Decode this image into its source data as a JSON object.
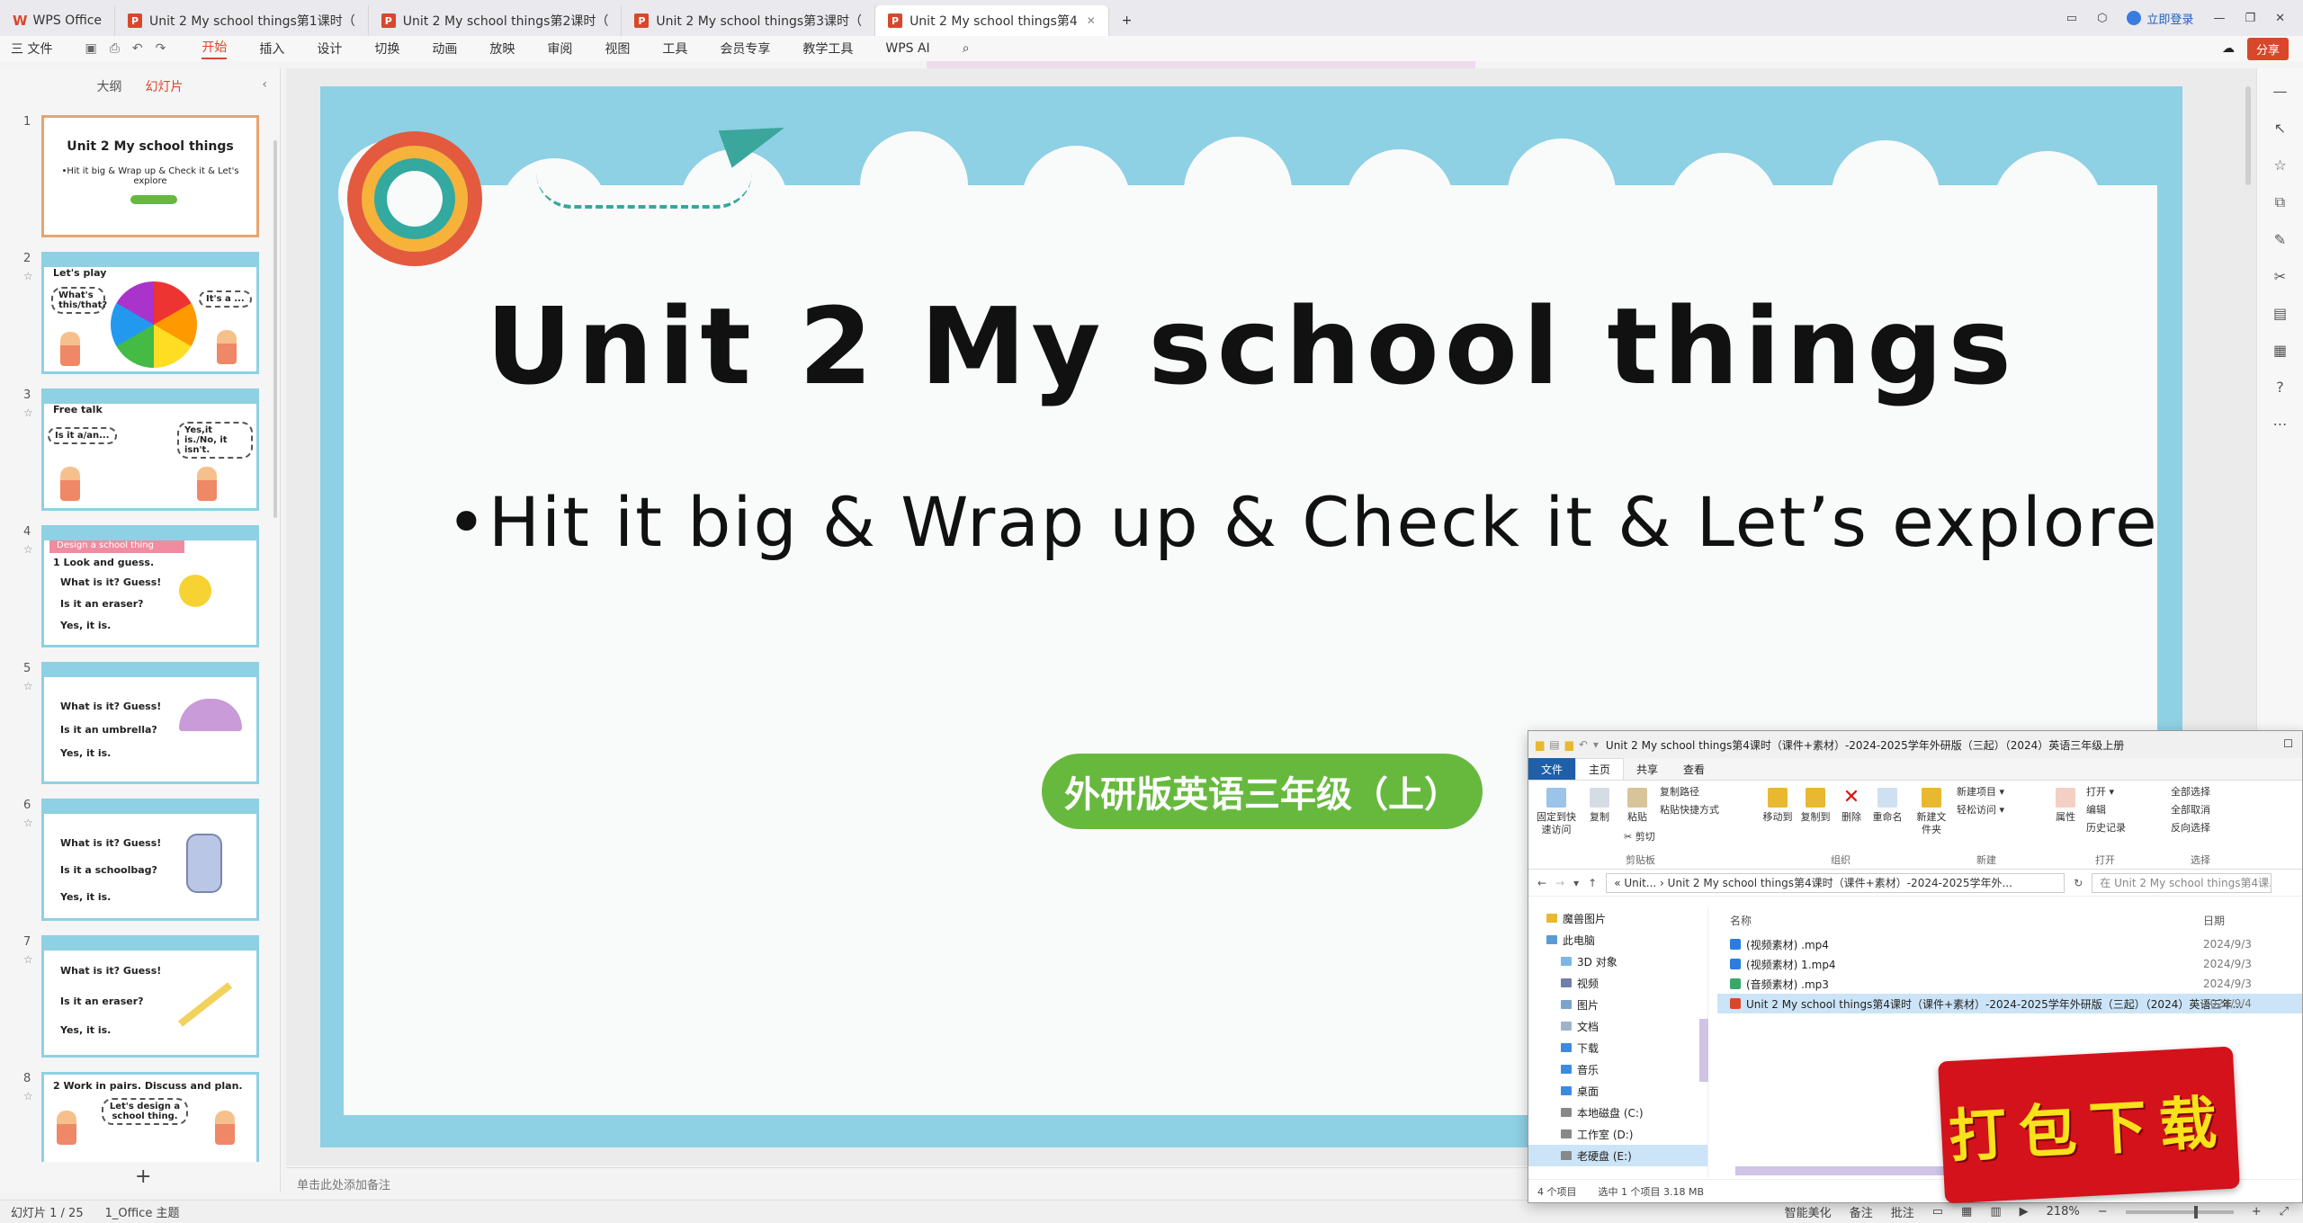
{
  "tabs": {
    "wps": "WPS Office",
    "t1": "Unit 2 My school things第1课时（",
    "t2": "Unit 2 My school things第2课时（",
    "t3": "Unit 2 My school things第3课时（",
    "t4": "Unit 2 My school things第4",
    "add": "+",
    "login": "立即登录"
  },
  "menu": {
    "file": "三 文件",
    "items": [
      "开始",
      "插入",
      "设计",
      "切换",
      "动画",
      "放映",
      "审阅",
      "视图",
      "工具",
      "会员专享",
      "教学工具"
    ],
    "wps_ai": "WPS AI",
    "share": "分享"
  },
  "left_panel": {
    "tab_outline": "大纲",
    "tab_slides": "幻灯片",
    "add": "+"
  },
  "thumbs": {
    "s1": {
      "num": "1",
      "title": "Unit 2 My school things",
      "sub": "•Hit it big & Wrap up & Check it & Let's explore"
    },
    "s2": {
      "num": "2",
      "a": "Let's play",
      "b": "What's this/that?",
      "c": "It's a ..."
    },
    "s3": {
      "num": "3",
      "a": "Free talk",
      "b": "Is it a/an...",
      "c": "Yes,it is./No, it isn't."
    },
    "s4": {
      "num": "4",
      "tag": "Design a school thing",
      "a": "1  Look and guess.",
      "b": "What is it? Guess!",
      "c": "Is it an eraser?",
      "d": "Yes, it is."
    },
    "s5": {
      "num": "5",
      "a": "What is it? Guess!",
      "b": "Is it an umbrella?",
      "c": "Yes, it is."
    },
    "s6": {
      "num": "6",
      "a": "What is it? Guess!",
      "b": "Is it a schoolbag?",
      "c": "Yes, it is."
    },
    "s7": {
      "num": "7",
      "a": "What is it? Guess!",
      "b": "Is it an eraser?",
      "c": "Yes, it is."
    },
    "s8": {
      "num": "8",
      "a": "2 Work in pairs. Discuss and plan.",
      "b": "Let's design a school thing."
    }
  },
  "slide": {
    "title": "Unit 2 My school things",
    "subtitle": "•Hit it big & Wrap up & Check it & Let’s explore",
    "badge": "外研版英语三年级（上）"
  },
  "notes_placeholder": "单击此处添加备注",
  "status": {
    "slide_count": "幻灯片 1 / 25",
    "theme": "1_Office 主题",
    "beautify": "智能美化",
    "notes": "备注",
    "comments": "批注",
    "zoom": "218%"
  },
  "explorer": {
    "title": "Unit 2 My school things第4课时（课件+素材）-2024-2025学年外研版（三起）（2024）英语三年级上册",
    "ribbon_tabs": [
      "文件",
      "主页",
      "共享",
      "查看"
    ],
    "buttons": {
      "pin": "固定到快速访问",
      "copy": "复制",
      "paste": "粘贴",
      "copy_path": "复制路径",
      "paste_shortcut": "粘贴快捷方式",
      "cut": "剪切",
      "move_to": "移动到",
      "copy_to": "复制到",
      "delete": "删除",
      "rename": "重命名",
      "new_folder": "新建文件夹",
      "new_item": "新建项目 ▾",
      "easy_access": "轻松访问 ▾",
      "properties": "属性",
      "open": "打开 ▾",
      "edit": "编辑",
      "history": "历史记录",
      "select_all": "全部选择",
      "select_none": "全部取消",
      "invert": "反向选择"
    },
    "groups": [
      "剪贴板",
      "组织",
      "新建",
      "打开",
      "选择"
    ],
    "path": "« Unit... › Unit 2 My school things第4课时（课件+素材）-2024-2025学年外...",
    "search": "在 Unit 2 My school things第4课...",
    "nav": [
      "魔兽图片",
      "此电脑",
      "3D 对象",
      "视频",
      "图片",
      "文档",
      "下载",
      "音乐",
      "桌面",
      "本地磁盘 (C:)",
      "工作室 (D:)",
      "老硬盘 (E:)"
    ],
    "col_name": "名称",
    "col_date": "日期",
    "files": [
      {
        "name": "(视频素材) .mp4",
        "date": "2024/9/3"
      },
      {
        "name": "(视频素材) 1.mp4",
        "date": "2024/9/3"
      },
      {
        "name": "(音频素材) .mp3",
        "date": "2024/9/3"
      },
      {
        "name": "Unit 2 My school things第4课时（课件+素材）-2024-2025学年外研版（三起）（2024）英语三年...",
        "date": "2024/9/4"
      }
    ],
    "status": {
      "count": "4 个项目",
      "selected": "选中 1 个项目  3.18 MB"
    }
  },
  "promo": "打包下载"
}
